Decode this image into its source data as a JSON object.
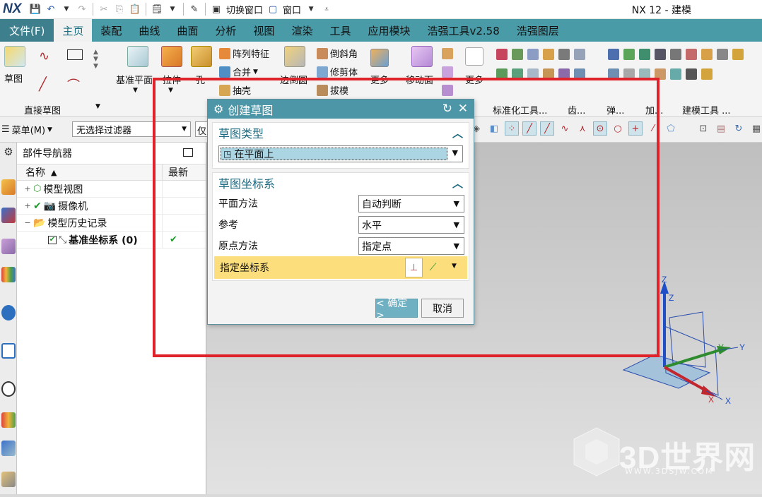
{
  "titlebar": {
    "logo": "NX",
    "switch_window": "切换窗口",
    "window_menu": "窗口",
    "app_title": "NX 12 - 建模"
  },
  "tabs": [
    {
      "label": "文件(F)",
      "kind": "file"
    },
    {
      "label": "主页",
      "kind": "active"
    },
    {
      "label": "装配"
    },
    {
      "label": "曲线"
    },
    {
      "label": "曲面"
    },
    {
      "label": "分析"
    },
    {
      "label": "视图"
    },
    {
      "label": "渲染"
    },
    {
      "label": "工具"
    },
    {
      "label": "应用模块"
    },
    {
      "label": "浩强工具v2.58"
    },
    {
      "label": "浩强图层"
    }
  ],
  "ribbon": {
    "sketch": "草图",
    "direct_sketch_group": "直接草图",
    "datum_plane": "基准平面",
    "extrude": "拉伸",
    "hole": "孔",
    "pattern_feature": "阵列特征",
    "unite": "合并",
    "shell": "抽壳",
    "edge_blend": "边倒圆",
    "chamfer": "倒斜角",
    "trim_body": "修剪体",
    "draft": "拔模",
    "more": "更多",
    "move_face": "移动面",
    "more2": "更多",
    "standard_tools": "标准化工具...",
    "gear": "齿...",
    "spring": "弹...",
    "add": "加...",
    "modeling_tools": "建模工具 ..."
  },
  "filterbar": {
    "menu": "菜单(M)",
    "filter": "无选择过滤器",
    "filter2": "仅"
  },
  "navigator": {
    "title": "部件导航器",
    "col_name": "名称",
    "col_latest": "最新",
    "rows": [
      {
        "expander": "+",
        "label": "模型视图",
        "latest": "",
        "bold": false
      },
      {
        "expander": "+",
        "label": "摄像机",
        "latest": "",
        "bold": false
      },
      {
        "expander": "−",
        "label": "模型历史记录",
        "latest": "",
        "bold": false
      },
      {
        "expander": "",
        "label": "基准坐标系 (0)",
        "latest": "✔",
        "bold": true
      }
    ]
  },
  "dialog": {
    "title": "创建草图",
    "section_type": "草图类型",
    "type_value": "在平面上",
    "section_csys": "草图坐标系",
    "plane_method_label": "平面方法",
    "plane_method_value": "自动判断",
    "reference_label": "参考",
    "reference_value": "水平",
    "origin_label": "原点方法",
    "origin_value": "指定点",
    "csys_label": "指定坐标系",
    "ok": "< 确定 >",
    "cancel": "取消"
  },
  "axes": {
    "z": "Z",
    "y": "Y",
    "x": "X"
  },
  "watermark": {
    "text": "3D世界网",
    "url": "WWW.3DSJW.COM"
  },
  "colors": {
    "tabbar": "#4a9ba8",
    "dialog_title": "#4c96a7",
    "highlight": "#e0222a",
    "csys_row": "#fdde7c"
  }
}
